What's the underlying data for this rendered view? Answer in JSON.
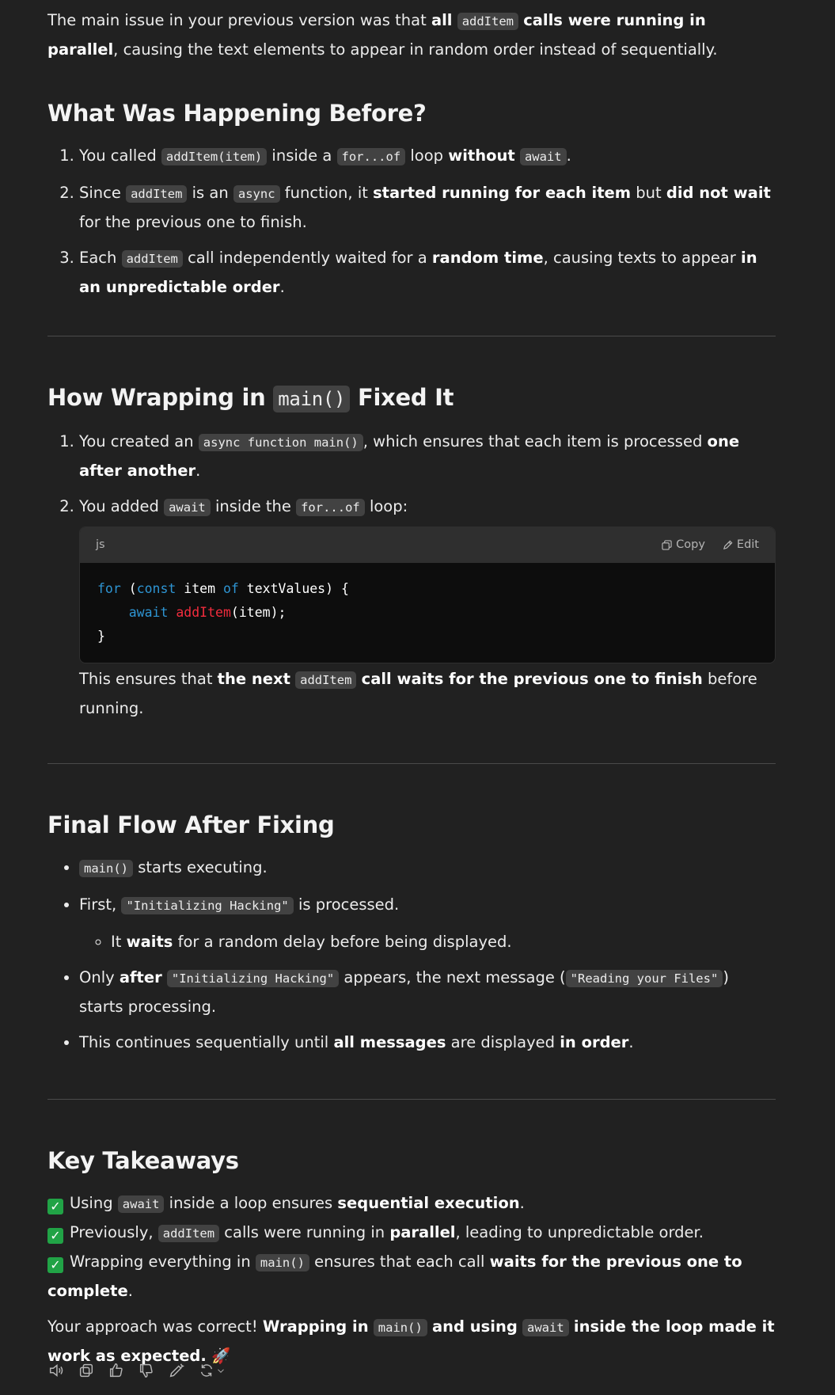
{
  "intro": {
    "t1": "The main issue in your previous version was that ",
    "b1": "all",
    "c1": "addItem",
    "b2": "calls were running in parallel",
    "t2": ", causing the text elements to appear in random order instead of sequentially."
  },
  "s1": {
    "title": "What Was Happening Before?",
    "i1": {
      "t1": "You called ",
      "c1": "addItem(item)",
      "t2": " inside a ",
      "c2": "for...of",
      "t3": " loop ",
      "b1": "without",
      "c3": "await",
      "t4": "."
    },
    "i2": {
      "t1": "Since ",
      "c1": "addItem",
      "t2": " is an ",
      "c2": "async",
      "t3": " function, it ",
      "b1": "started running for each item",
      "t4": " but ",
      "b2": "did not wait",
      "t5": " for the previous one to finish."
    },
    "i3": {
      "t1": "Each ",
      "c1": "addItem",
      "t2": " call independently waited for a ",
      "b1": "random time",
      "t3": ", causing texts to appear ",
      "b2": "in an unpredictable order",
      "t4": "."
    }
  },
  "s2": {
    "title_pre": "How Wrapping in ",
    "title_code": "main()",
    "title_post": " Fixed It",
    "i1": {
      "t1": "You created an ",
      "c1": "async function main()",
      "t2": ", which ensures that each item is processed ",
      "b1": "one after another",
      "t3": "."
    },
    "i2": {
      "t1": "You added ",
      "c1": "await",
      "t2": " inside the ",
      "c2": "for...of",
      "t3": " loop:"
    },
    "code": {
      "lang": "js",
      "copy": "Copy",
      "edit": "Edit",
      "l1_kw1": "for",
      "l1_a": " (",
      "l1_kw2": "const",
      "l1_b": " item ",
      "l1_kw3": "of",
      "l1_c": " textValues) {",
      "l2_indent": "    ",
      "l2_kw": "await",
      "l2_sp": " ",
      "l2_fn": "addItem",
      "l2_rest": "(item);",
      "l3": "}"
    },
    "after": {
      "t1": "This ensures that ",
      "b1": "the next",
      "c1": "addItem",
      "b2": "call waits for the previous one to finish",
      "t2": " before running."
    }
  },
  "s3": {
    "title": "Final Flow After Fixing",
    "i1": {
      "c1": "main()",
      "t1": " starts executing."
    },
    "i2": {
      "t1": "First, ",
      "c1": "\"Initializing Hacking\"",
      "t2": " is processed."
    },
    "i2sub": {
      "t1": "It ",
      "b1": "waits",
      "t2": " for a random delay before being displayed."
    },
    "i3": {
      "t1": "Only ",
      "b1": "after",
      "c1": "\"Initializing Hacking\"",
      "t2": " appears, the next message (",
      "c2": "\"Reading your Files\"",
      "t3": ") starts processing."
    },
    "i4": {
      "t1": "This continues sequentially until ",
      "b1": "all messages",
      "t2": " are displayed ",
      "b2": "in order",
      "t3": "."
    }
  },
  "s4": {
    "title": "Key Takeaways",
    "check": "✓",
    "l1": {
      "t1": "Using ",
      "c1": "await",
      "t2": " inside a loop ensures ",
      "b1": "sequential execution",
      "t3": "."
    },
    "l2": {
      "t1": "Previously, ",
      "c1": "addItem",
      "t2": " calls were running in ",
      "b1": "parallel",
      "t3": ", leading to unpredictable order."
    },
    "l3": {
      "t1": "Wrapping everything in ",
      "c1": "main()",
      "t2": " ensures that each call ",
      "b1": "waits for the previous one to complete",
      "t3": "."
    }
  },
  "closing": {
    "t1": "Your approach was correct! ",
    "b1": "Wrapping in",
    "c1": "main()",
    "b2": "and using",
    "c2": "await",
    "b3": "inside the loop made it work as expected.",
    "emoji": " 🚀"
  },
  "toolbar": {
    "icons": [
      "read-aloud-icon",
      "copy-icon",
      "thumbs-up-icon",
      "thumbs-down-icon",
      "edit-canvas-icon",
      "regenerate-icon",
      "chevron-down-icon"
    ]
  }
}
